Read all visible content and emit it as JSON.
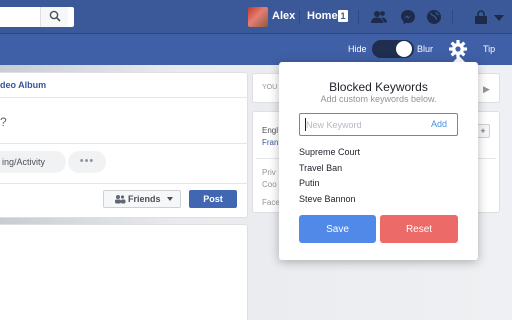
{
  "topbar": {
    "user_name": "Alex",
    "home_label": "Home",
    "home_badge": "1",
    "icons": [
      "search-icon",
      "friend-requests-icon",
      "messenger-icon",
      "globe-icon",
      "lock-icon",
      "dropdown-icon"
    ]
  },
  "extension_bar": {
    "hide_label": "Hide",
    "blur_label": "Blur",
    "toggle_state": "on",
    "tip_label": "Tip",
    "settings_icon": "gear-icon"
  },
  "feed": {
    "album_text": "deo Album",
    "composer_question": "?",
    "feeling_label": "ing/Activity",
    "more_label": "•••",
    "audience_label": "Friends",
    "post_label": "Post"
  },
  "right_column": {
    "header_text": "YOU",
    "language_text": "Engl",
    "language_link": "Fran",
    "privacy_text": "Priv",
    "cookies_text": "Coo",
    "facebook_text": "Face"
  },
  "popup": {
    "title": "Blocked Keywords",
    "subtitle": "Add custom keywords below.",
    "input_placeholder": "New Keyword",
    "input_value": "",
    "add_label": "Add",
    "keywords": [
      "Supreme Court",
      "Travel Ban",
      "Putin",
      "Steve Bannon"
    ],
    "save_label": "Save",
    "reset_label": "Reset"
  },
  "colors": {
    "facebook_blue": "#3b5998",
    "band_blue": "#3f5fa6",
    "save_blue": "#5189e8",
    "reset_red": "#ec6a67",
    "focus_blue": "#4a90e2"
  }
}
